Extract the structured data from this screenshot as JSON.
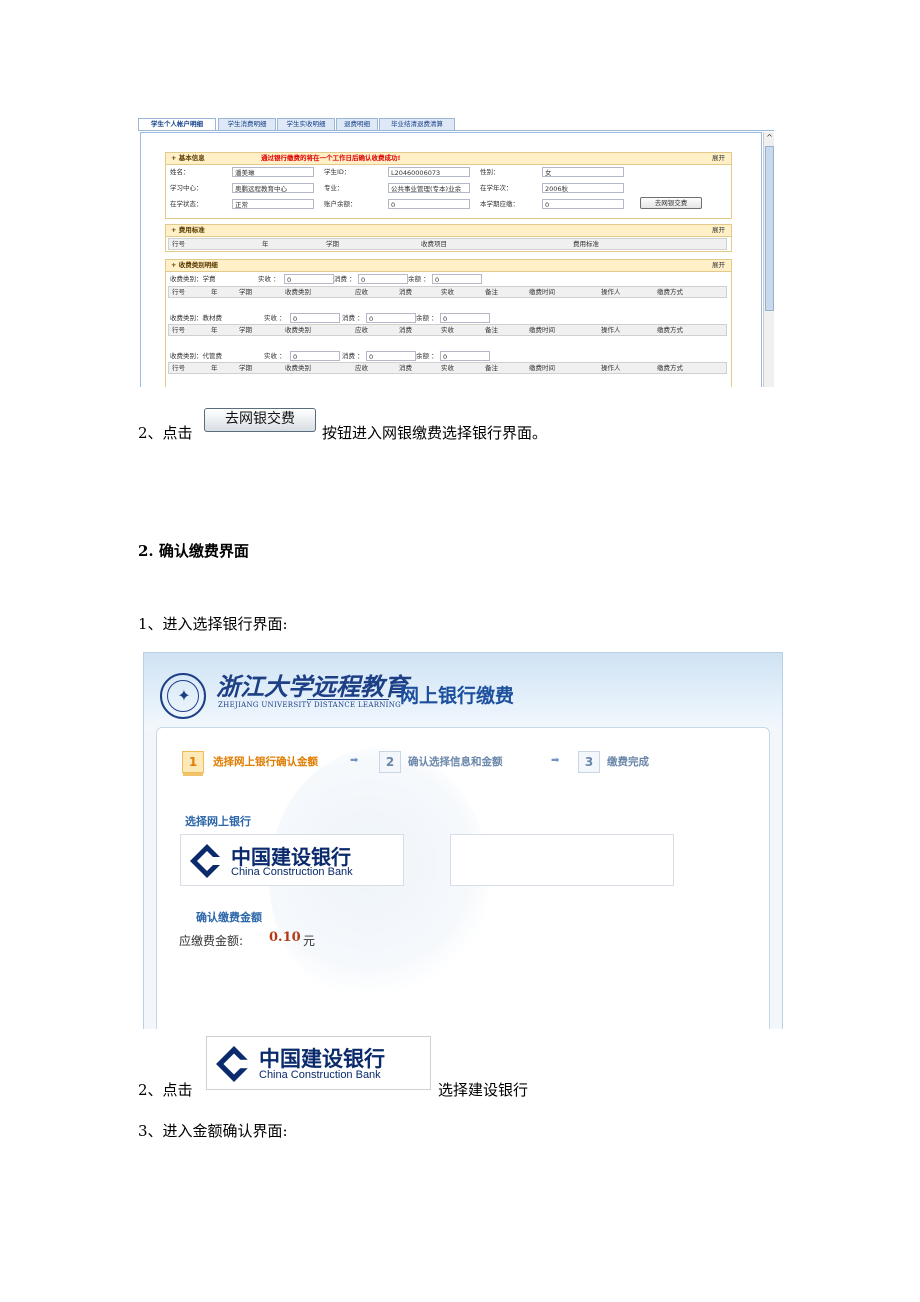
{
  "shot1": {
    "tabs": [
      "学生个人帐户明细",
      "学生消费明细",
      "学生实收明细",
      "退费明细",
      "毕业结清退费清算"
    ],
    "basic": {
      "title": "基本信息",
      "warning": "通过银行缴费的将在一个工作日后确认收费成功!",
      "expand": "展开",
      "labels": {
        "name": "姓名：",
        "student_id": "学生ID：",
        "gender": "性别：",
        "center": "学习中心：",
        "major": "专业：",
        "grade": "在学年次：",
        "status": "在学状态：",
        "balance": "账户余额：",
        "due": "本学期应缴："
      },
      "values": {
        "name": "潘美琳",
        "student_id": "L20460006073",
        "gender": "女",
        "center": "奥鹏远程教育中心",
        "major": "公共事业管理(专本)业余",
        "grade": "2006秋",
        "status": "正常",
        "balance": "0",
        "due": "0"
      },
      "button": "去网银交费"
    },
    "fee_standard": {
      "title": "费用标准",
      "expand": "展开",
      "columns": [
        "行号",
        "年",
        "学期",
        "收费项目",
        "费用标准"
      ]
    },
    "detail": {
      "title": "收费类别明细",
      "expand": "展开",
      "columns": [
        "行号",
        "年",
        "学期",
        "收费类别",
        "应收",
        "消费",
        "实收",
        "备注",
        "缴费时间",
        "操作人",
        "缴费方式"
      ],
      "groups": [
        {
          "category": "收费类别：学费",
          "received_label": "实收 ：",
          "received": "0",
          "spent_label": "消费 ：",
          "spent": "0",
          "balance_label": "余额 ：",
          "balance": "0"
        },
        {
          "category": "收费类别：教材费",
          "received_label": "实收 ：",
          "received": "0",
          "spent_label": "消费 ：",
          "spent": "0",
          "balance_label": "余额 ：",
          "balance": "0"
        },
        {
          "category": "收费类别：代管费",
          "received_label": "实收 ：",
          "received": "0",
          "spent_label": "消费 ：",
          "spent": "0",
          "balance_label": "余额 ：",
          "balance": "0"
        }
      ]
    }
  },
  "doc": {
    "line1_prefix": "2、点击",
    "inline_button": "去网银交费",
    "line1_suffix": "按钮进入网银缴费选择银行界面。",
    "heading": "2.   确认缴费界面",
    "line2": "1、进入选择银行界面:",
    "line3_prefix": "2、点击",
    "line3_suffix": "选择建设银行",
    "line4": "3、进入金额确认界面:"
  },
  "shot2": {
    "univ_cn": "浙江大学远程教育",
    "univ_en": "ZHEJIANG UNIVERSITY DISTANCE LEARNING",
    "system_title": "网上银行缴费",
    "steps": [
      {
        "num": "1",
        "label": "选择网上银行确认金额"
      },
      {
        "num": "2",
        "label": "确认选择信息和金额"
      },
      {
        "num": "3",
        "label": "缴费完成"
      }
    ],
    "arrow": "➡",
    "choose_bank": "选择网上银行",
    "confirm_amount": "确认缴费金额",
    "amount_label": "应缴费金额:",
    "amount_value": "0.10",
    "amount_unit": "元"
  },
  "bank": {
    "cn": "中国建设银行",
    "en": "China Construction Bank",
    "brand_color": "#0a2a6b"
  }
}
